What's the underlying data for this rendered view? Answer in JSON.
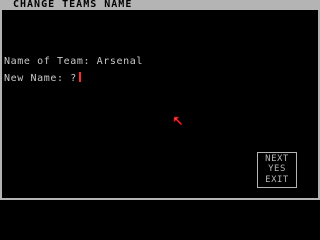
{
  "header": {
    "title": "CHANGE TEAMS NAME"
  },
  "form": {
    "team_label": "Name of Team: Arsenal",
    "new_name_prompt": "New Name: ?"
  },
  "menu": {
    "next_label": "NEXT",
    "yes_label": "YES",
    "exit_label": "EXIT"
  },
  "colors": {
    "frame": "#b4b4b4",
    "background": "#000000",
    "text": "#c8c8c8",
    "cursor": "#ff2a2a"
  },
  "icons": {
    "pointer": "arrow-pointer-icon"
  }
}
